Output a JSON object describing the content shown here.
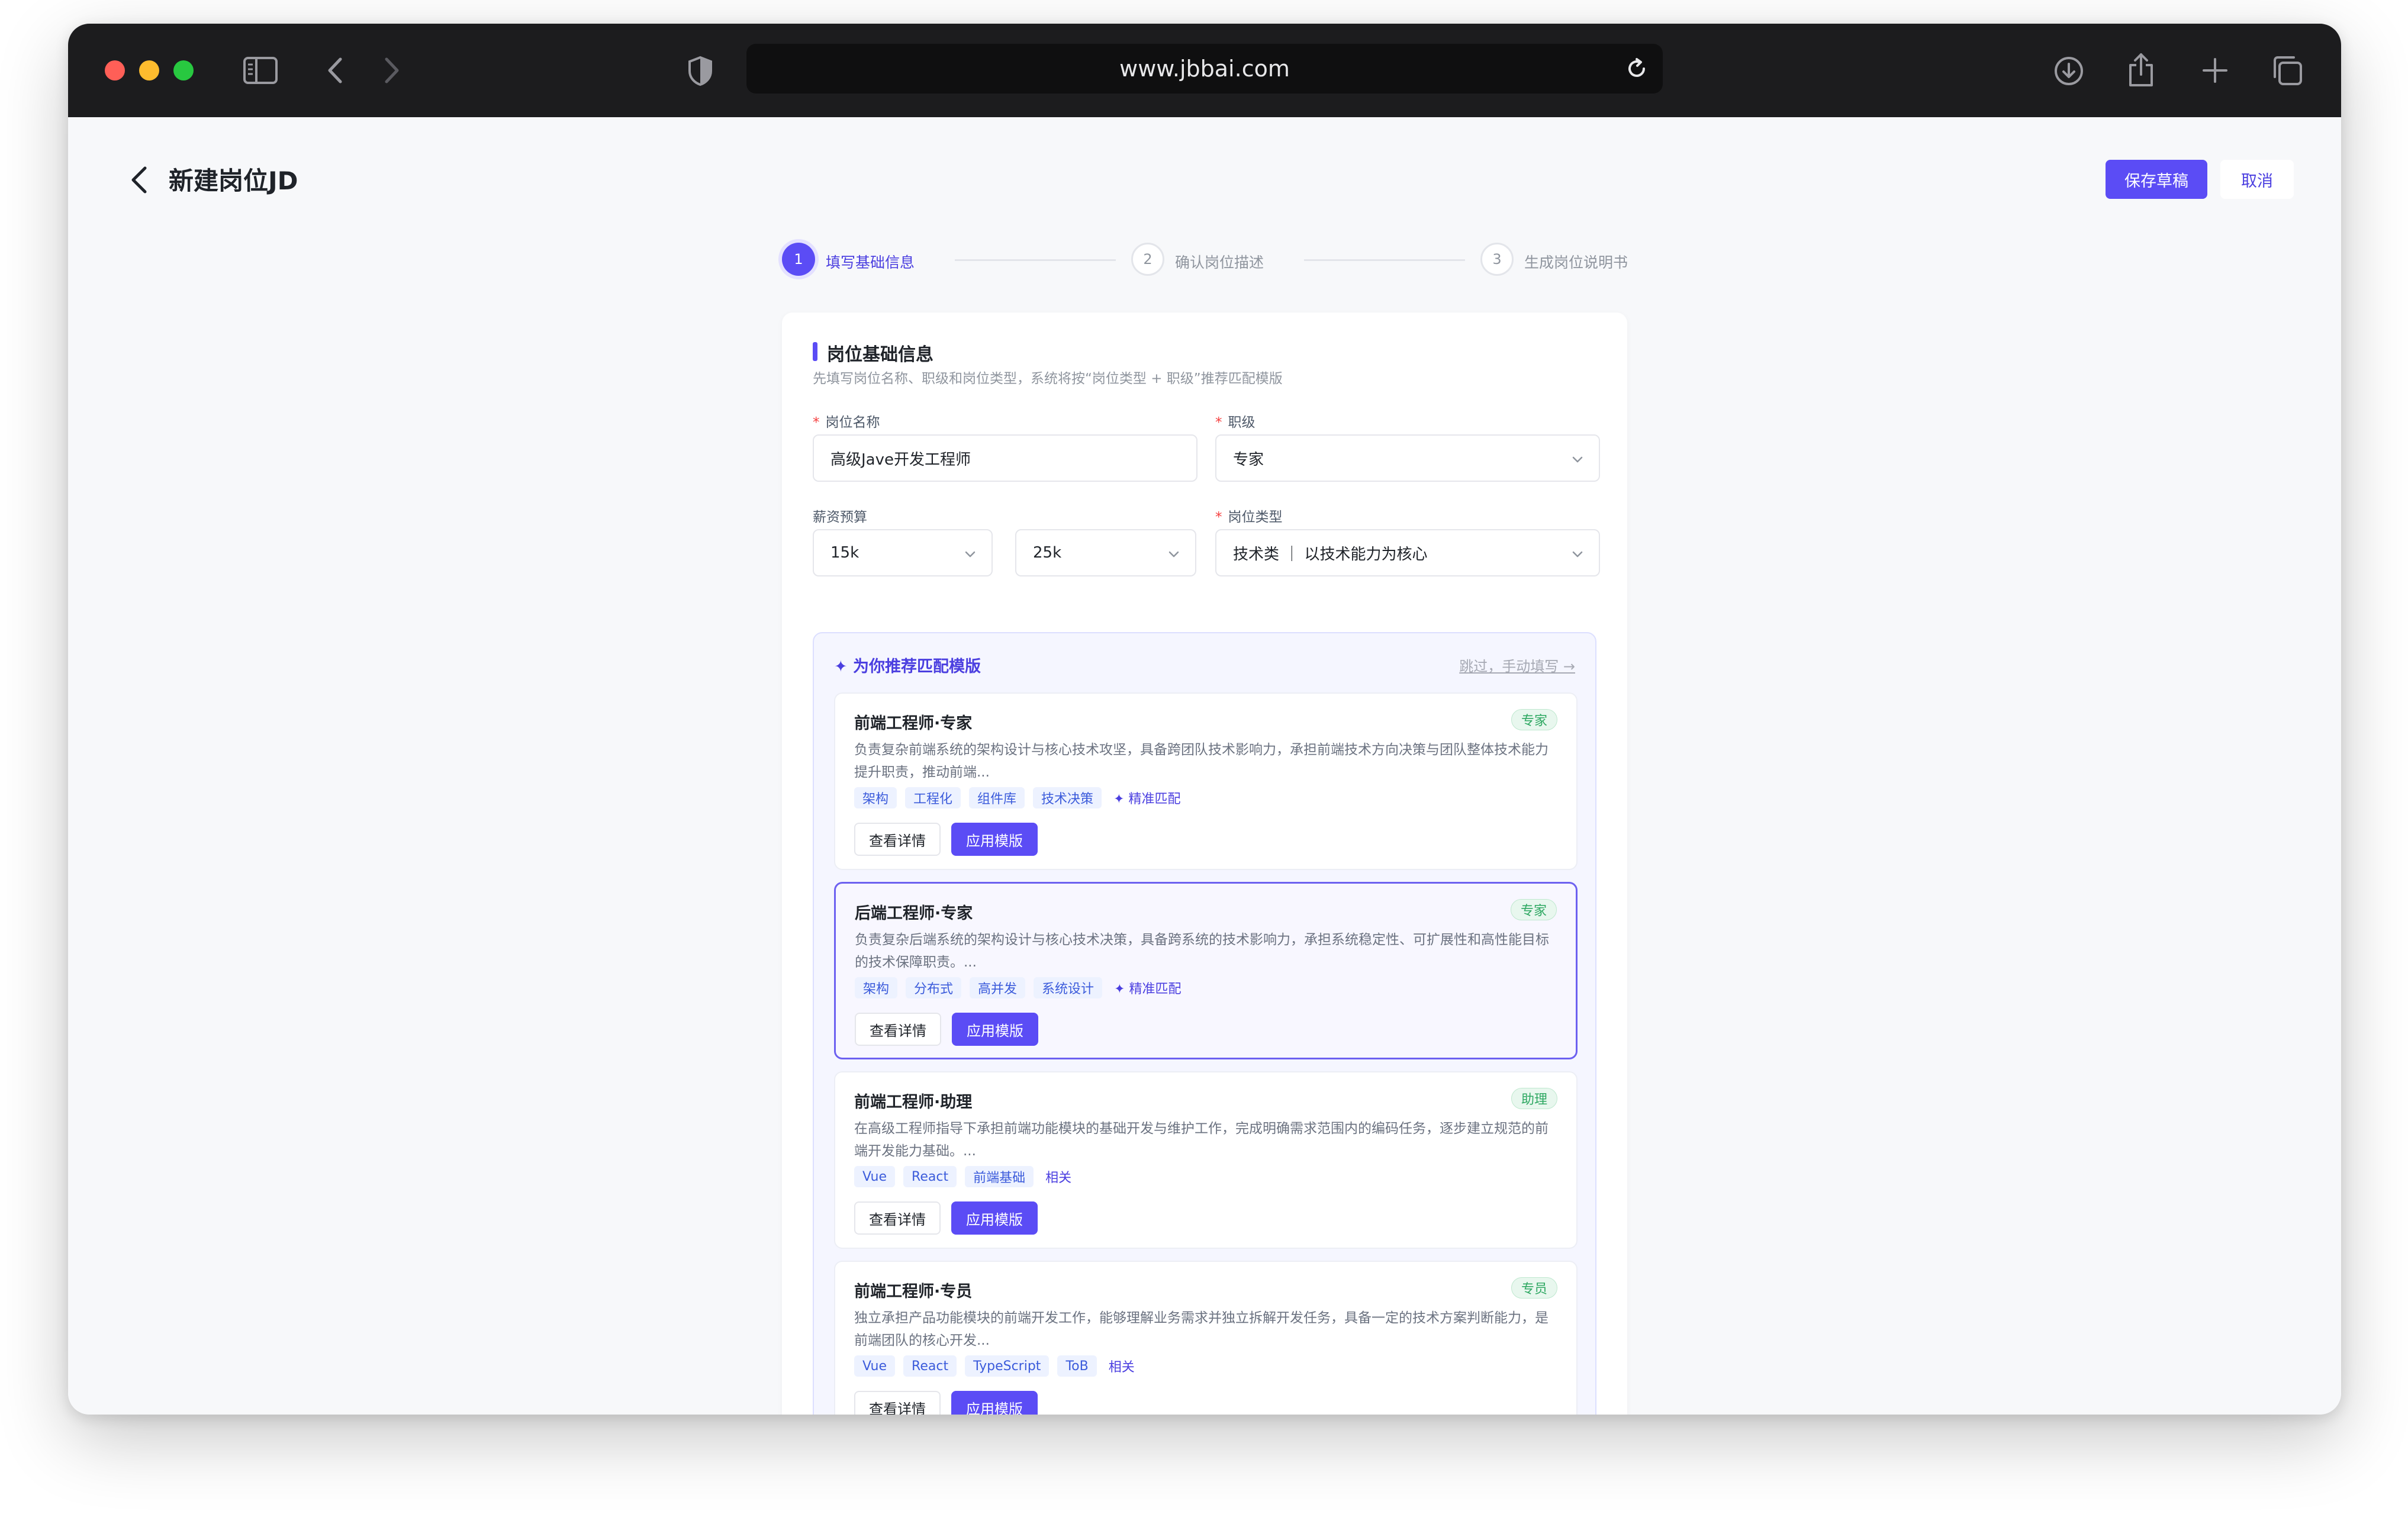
{
  "browser": {
    "url": "www.jbbai.com"
  },
  "header": {
    "title": "新建岗位JD",
    "save_label": "保存草稿",
    "cancel_label": "取消"
  },
  "steps": [
    {
      "num": "1",
      "label": "填写基础信息"
    },
    {
      "num": "2",
      "label": "确认岗位描述"
    },
    {
      "num": "3",
      "label": "生成岗位说明书"
    }
  ],
  "section": {
    "title": "岗位基础信息",
    "subtitle": "先填写岗位名称、职级和岗位类型，系统将按“岗位类型 + 职级”推荐匹配模版"
  },
  "form": {
    "name_label": "岗位名称",
    "name_value": "高级Jave开发工程师",
    "level_label": "职级",
    "level_value": "专家",
    "salary_label": "薪资预算",
    "salary_min": "15k",
    "salary_sep": "-",
    "salary_max": "25k",
    "type_label": "岗位类型",
    "type_value": "技术类 ｜ 以技术能力为核心"
  },
  "recommend": {
    "title": "✦ 为你推荐匹配模版",
    "skip": "跳过，手动填写 →",
    "view_label": "查看详情",
    "apply_label": "应用模版",
    "templates": [
      {
        "title": "前端工程师·专家",
        "badge": "专家",
        "desc": "负责复杂前端系统的架构设计与核心技术攻坚，具备跨团队技术影响力，承担前端技术方向决策与团队整体技术能力提升职责，推动前端...",
        "tags": [
          "架构",
          "工程化",
          "组件库",
          "技术决策"
        ],
        "note": "✦ 精准匹配"
      },
      {
        "title": "后端工程师·专家",
        "badge": "专家",
        "desc": "负责复杂后端系统的架构设计与核心技术决策，具备跨系统的技术影响力，承担系统稳定性、可扩展性和高性能目标的技术保障职责。...",
        "tags": [
          "架构",
          "分布式",
          "高并发",
          "系统设计"
        ],
        "note": "✦ 精准匹配"
      },
      {
        "title": "前端工程师·助理",
        "badge": "助理",
        "desc": "在高级工程师指导下承担前端功能模块的基础开发与维护工作，完成明确需求范围内的编码任务，逐步建立规范的前端开发能力基础。...",
        "tags": [
          "Vue",
          "React",
          "前端基础"
        ],
        "note": "相关"
      },
      {
        "title": "前端工程师·专员",
        "badge": "专员",
        "desc": "独立承担产品功能模块的前端开发工作，能够理解业务需求并独立拆解开发任务，具备一定的技术方案判断能力，是前端团队的核心开发...",
        "tags": [
          "Vue",
          "React",
          "TypeScript",
          "ToB"
        ],
        "note": "相关"
      }
    ]
  },
  "colors": {
    "accent": "#5b4cf5",
    "required": "#f53f3f",
    "badge_green": "#2ea862"
  },
  "icons": [
    "sidebar-icon",
    "back-icon",
    "forward-icon",
    "shield-icon",
    "reload-icon",
    "download-icon",
    "share-icon",
    "plus-icon",
    "tabs-icon",
    "chevron-left-icon",
    "chevron-down-icon"
  ]
}
